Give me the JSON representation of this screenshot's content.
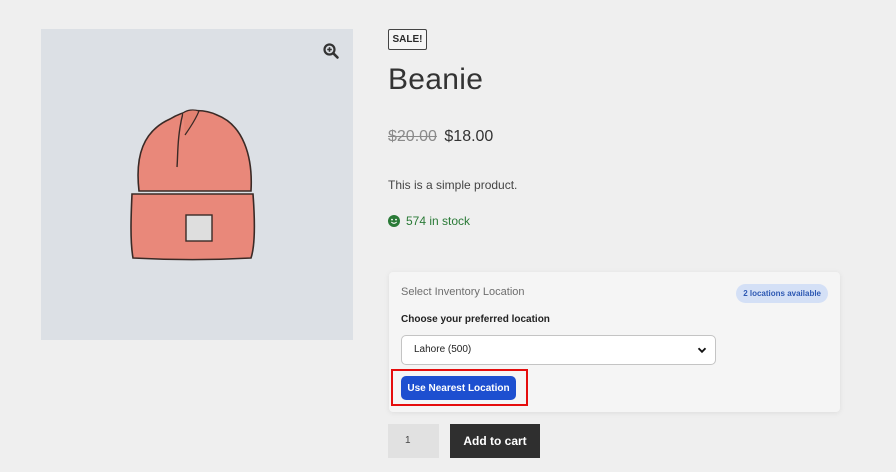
{
  "product": {
    "sale_badge": "SALE!",
    "title": "Beanie",
    "price_old": "$20.00",
    "price_new": "$18.00",
    "description": "This is a simple product.",
    "stock": "574 in stock",
    "image_icon": "beanie-hat-illustration",
    "zoom_icon": "magnifier-plus-icon"
  },
  "location": {
    "header": "Select Inventory Location",
    "count_badge": "2 locations available",
    "label": "Choose your preferred location",
    "selected": "Lahore (500)",
    "nearest_button": "Use Nearest Location"
  },
  "cart": {
    "quantity": "1",
    "add_button": "Add to cart"
  },
  "colors": {
    "accent_blue": "#1d4fd0",
    "stock_green": "#2a7a37",
    "highlight_red": "#e50d0d",
    "cart_button": "#2f2f2f"
  }
}
